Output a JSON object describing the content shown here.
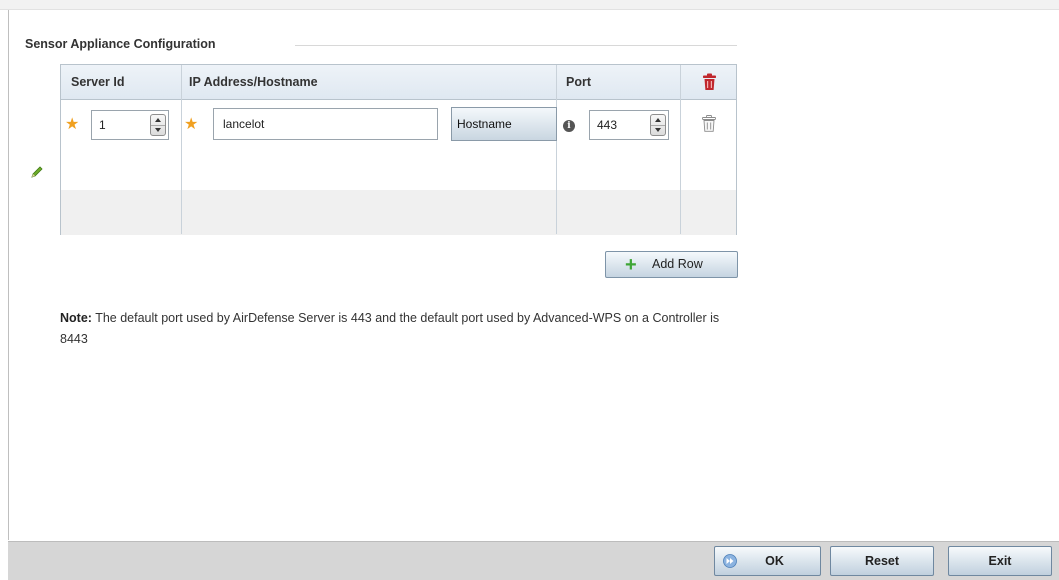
{
  "section": {
    "title": "Sensor Appliance Configuration"
  },
  "table": {
    "headers": {
      "server_id": "Server Id",
      "ip_hostname": "IP Address/Hostname",
      "port": "Port"
    },
    "rows": [
      {
        "server_id": "1",
        "ip_hostname": "lancelot",
        "address_type": "Hostname",
        "port": "443"
      }
    ]
  },
  "add_row": {
    "label": "Add Row"
  },
  "note": {
    "label": "Note:",
    "text": " The default port used by AirDefense Server is 443 and the default port used by Advanced-WPS on a Controller is 8443"
  },
  "footer": {
    "ok_label": "OK",
    "reset_label": "Reset",
    "exit_label": "Exit"
  },
  "colors": {
    "required_star": "#f0a020",
    "delete_icon": "#c0272d",
    "add_plus": "#3ea535"
  },
  "icons": {
    "header_delete": "trash-icon",
    "row_delete": "trash-icon",
    "edit": "pencil-icon",
    "info": "info-icon",
    "ok": "forward-icon",
    "add": "plus-icon"
  }
}
